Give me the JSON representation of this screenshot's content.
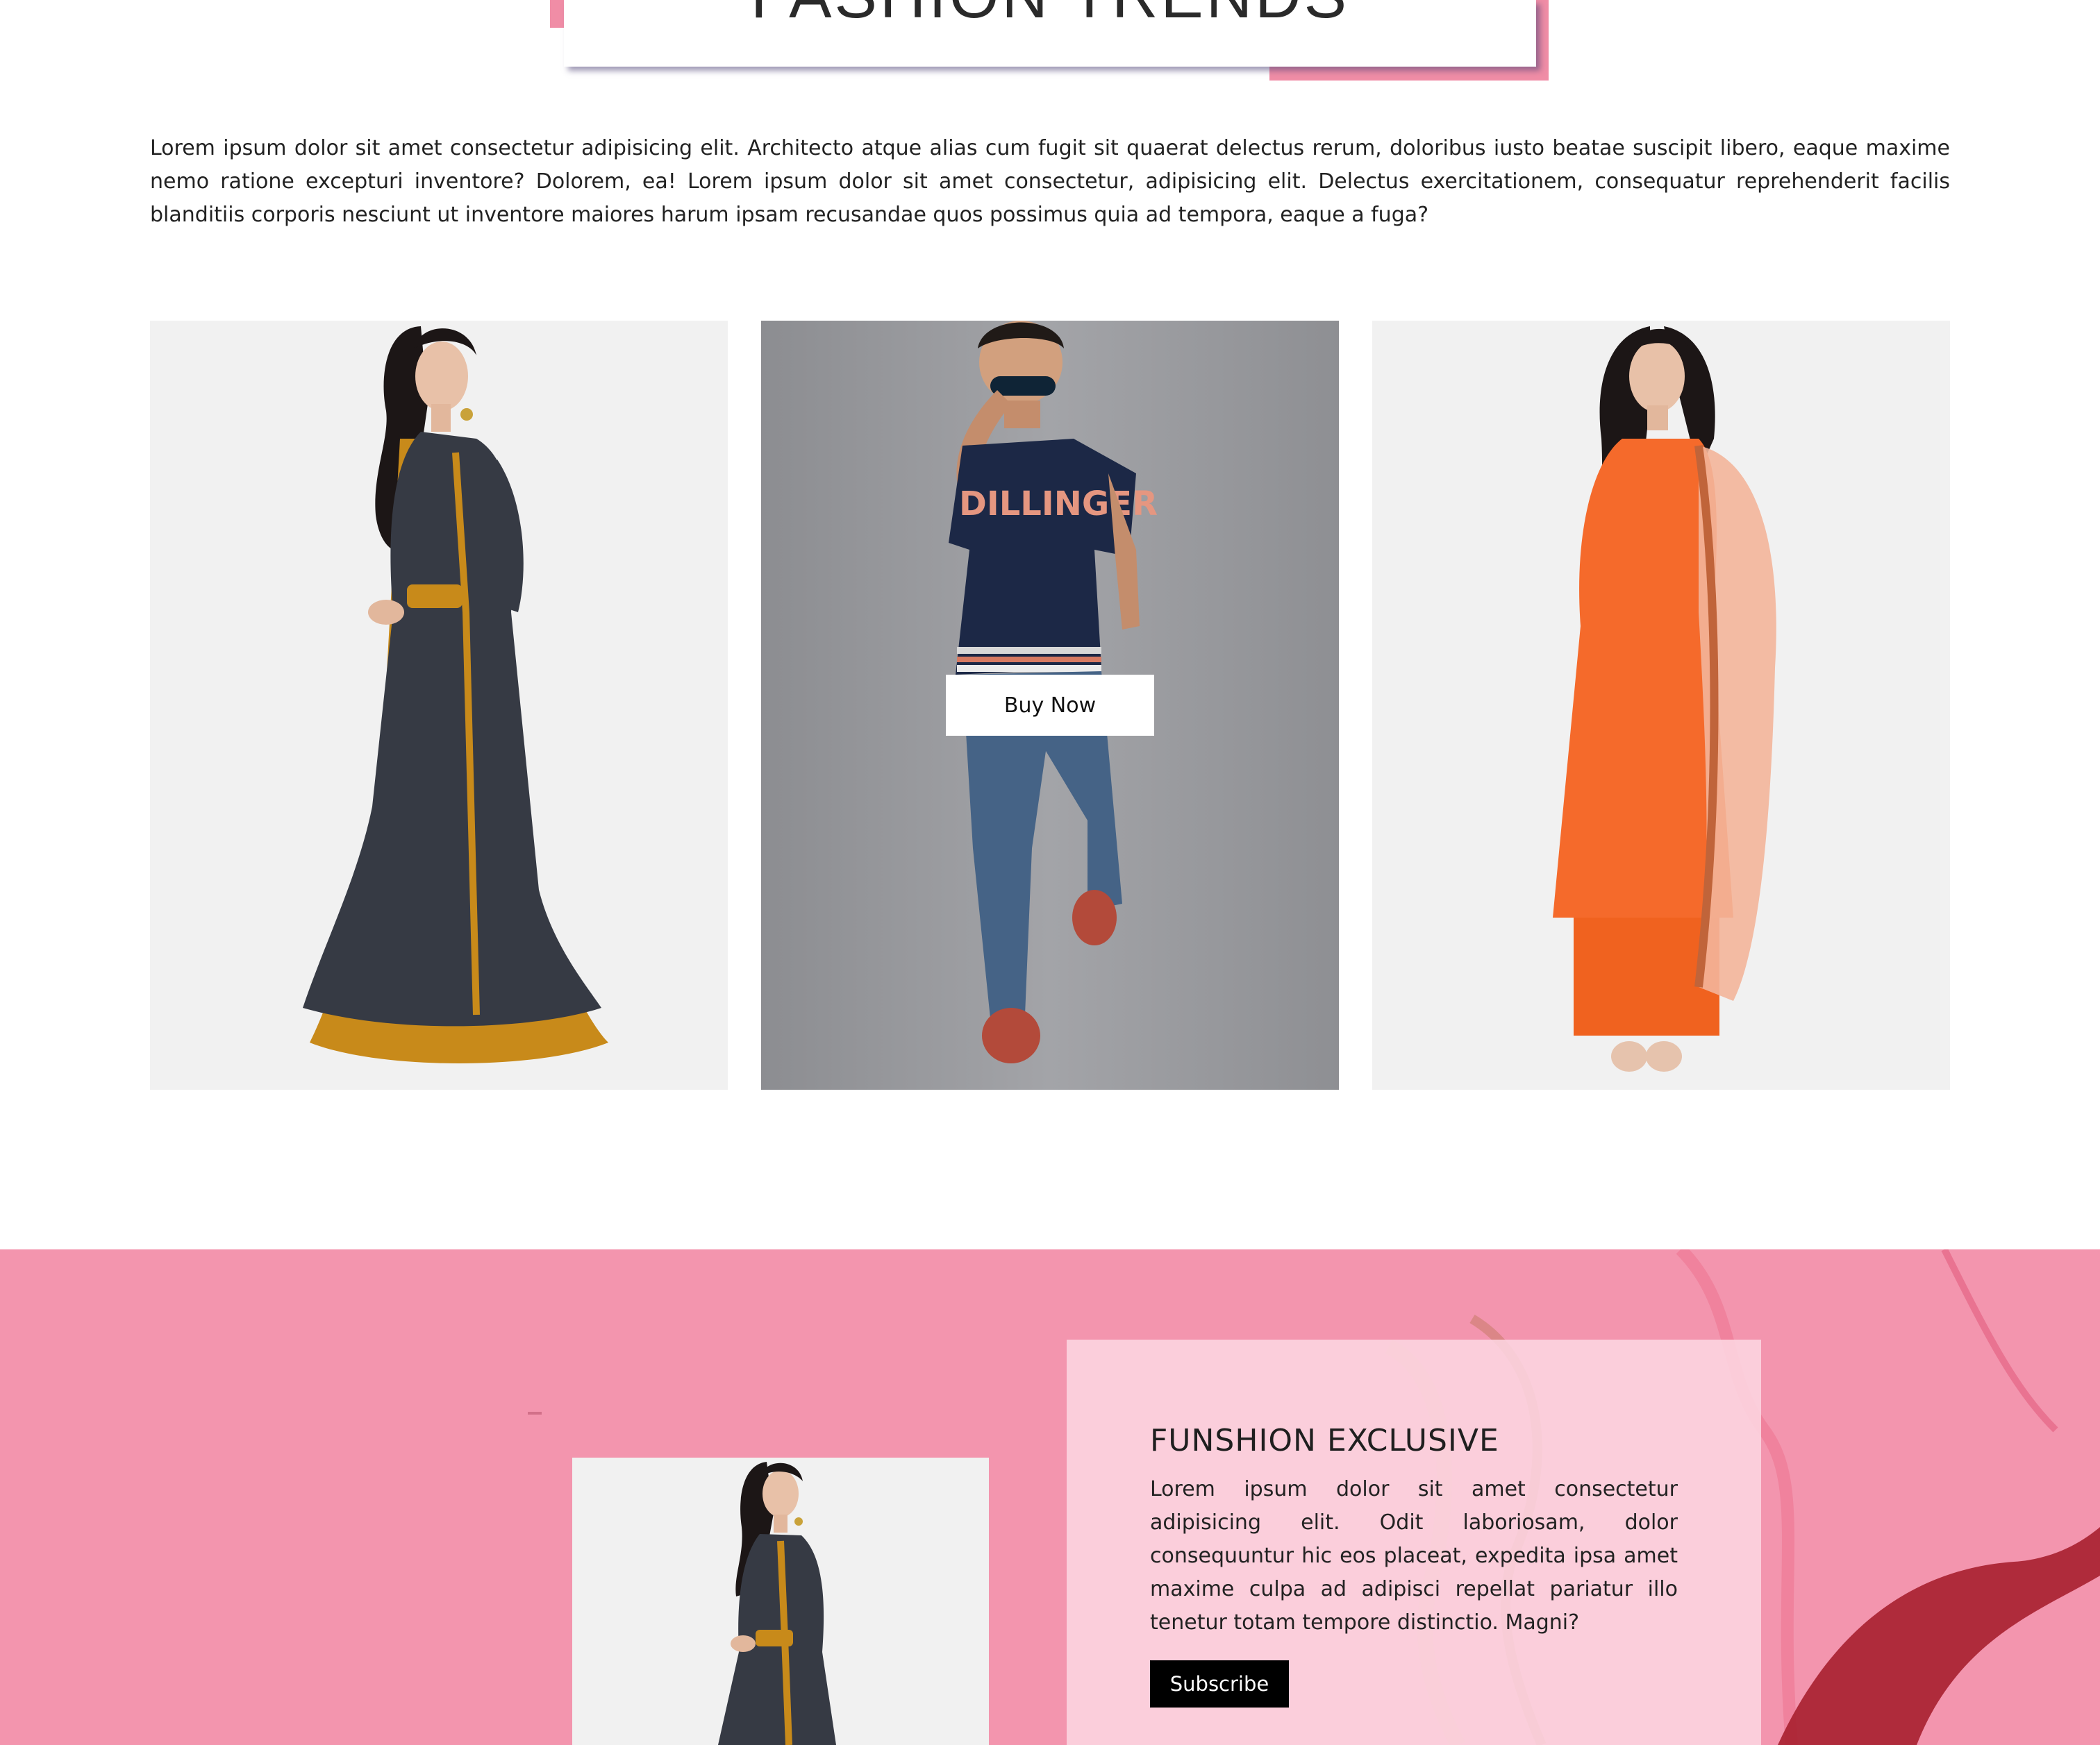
{
  "header": {
    "title": "FASHION TRENDS"
  },
  "intro": {
    "text": "Lorem ipsum dolor sit amet consectetur adipisicing elit. Architecto atque alias cum fugit sit quaerat delectus rerum, doloribus iusto beatae suscipit libero, eaque maxime nemo ratione excepturi inventore? Dolorem, ea! Lorem ipsum dolor sit amet consectetur, adipisicing elit. Delectus exercitationem, consequatur reprehenderit facilis blanditiis corporis nesciunt ut inventore maiores harum ipsam recusandae quos possimus quia ad tempora, eaque a fuga?"
  },
  "products": {
    "items": [
      {
        "image": "woman-grey-anarkali-gown"
      },
      {
        "image": "man-navy-tshirt-jeans",
        "shirt_text": "DILLINGER",
        "button_label": "Buy Now"
      },
      {
        "image": "woman-orange-kurta-dupatta"
      }
    ]
  },
  "exclusive": {
    "title": "FUNSHION EXCLUSIVE",
    "text": "Lorem ipsum dolor sit amet consectetur adipisicing elit. Odit laboriosam, dolor consequuntur hic eos placeat, expedita ipsa amet maxime culpa ad adipisci repellat pariatur illo tenetur totam tempore distinctio. Magni?",
    "button_label": "Subscribe"
  },
  "colors": {
    "accent_pink": "#f08da6",
    "section_pink": "#f395ae",
    "card_pink": "#fcd6e1",
    "button_dark": "#000000"
  }
}
